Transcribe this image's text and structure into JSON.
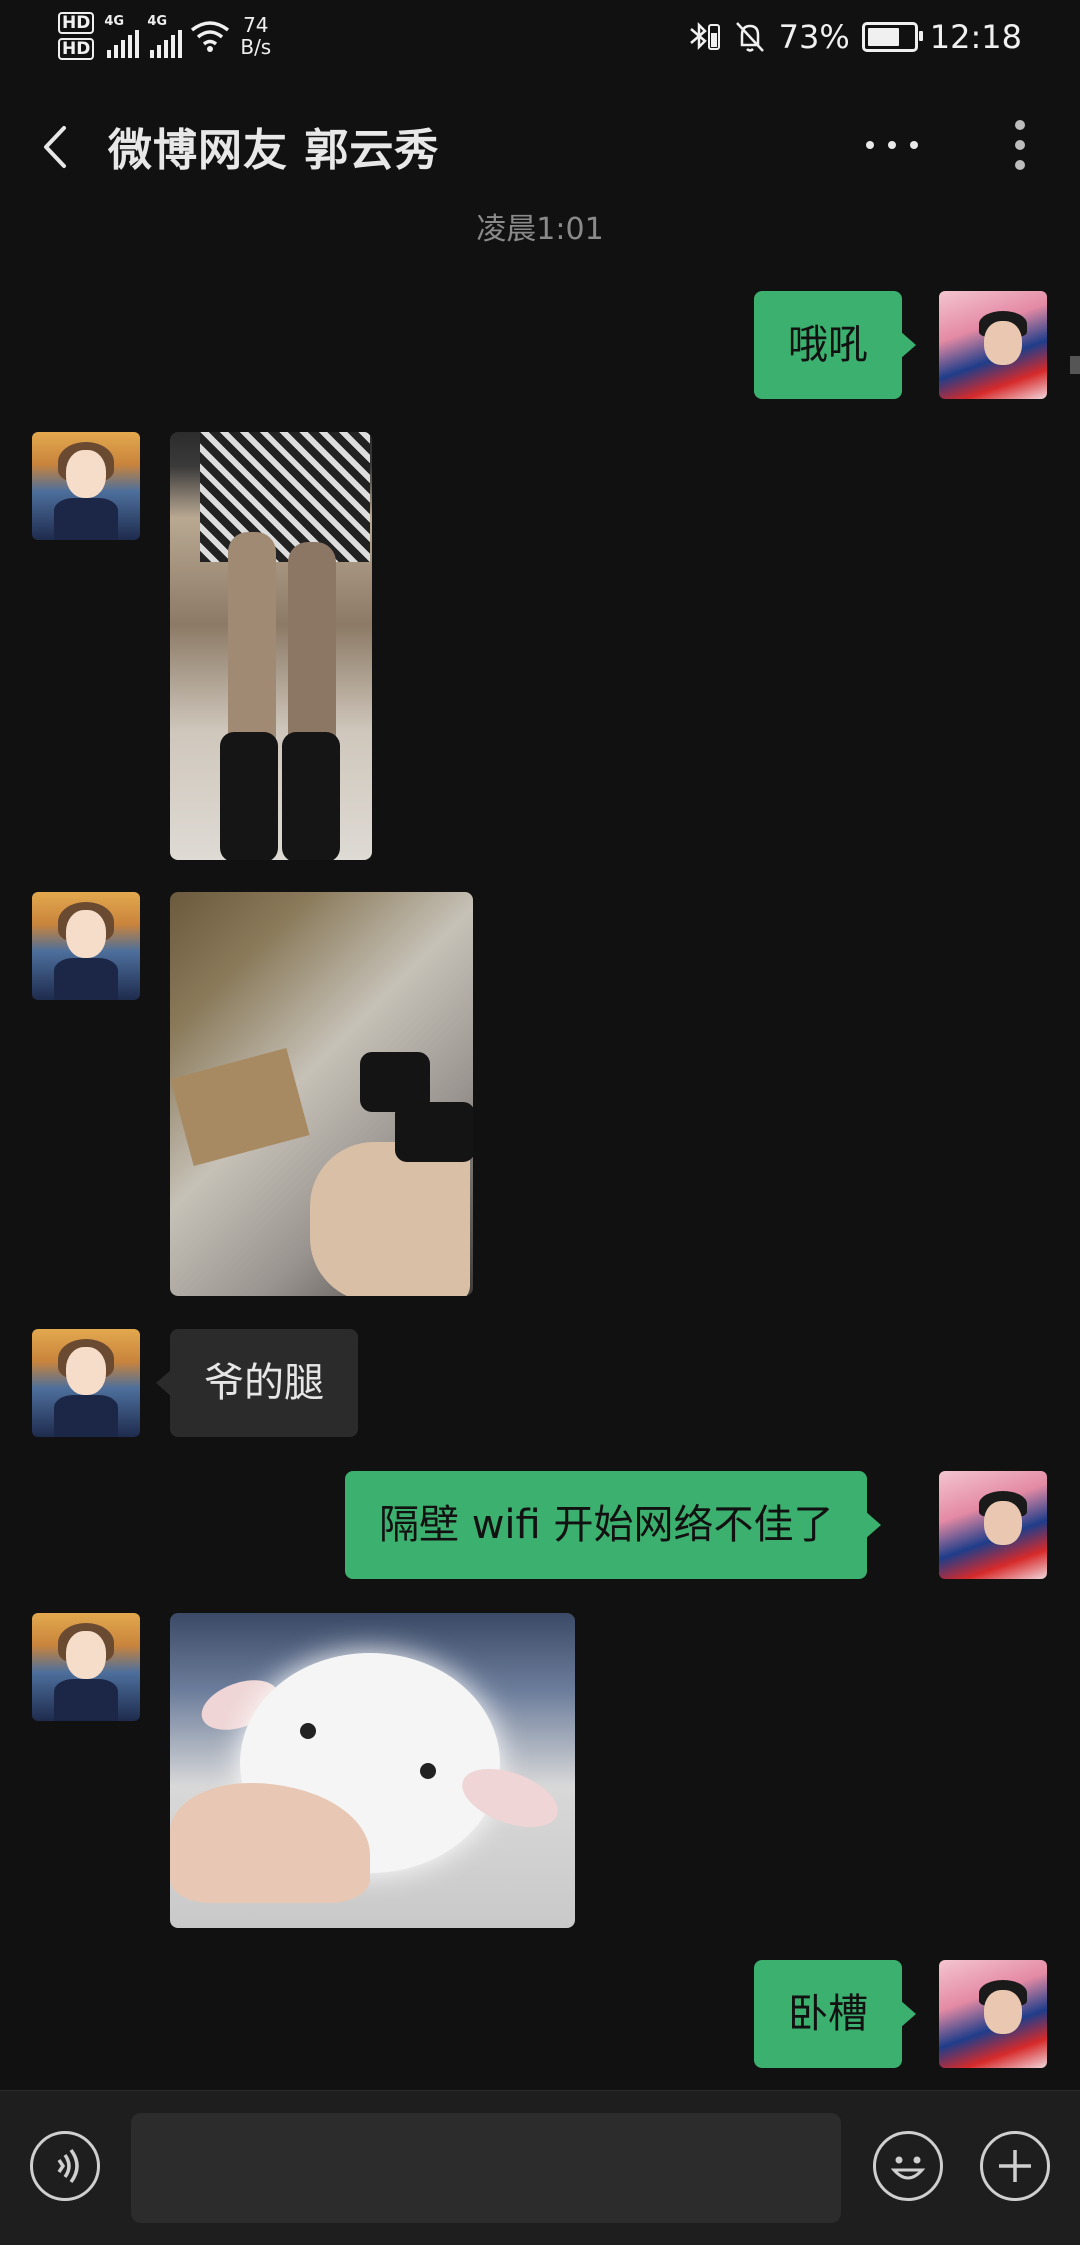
{
  "status_bar": {
    "hd1": "HD",
    "hd2": "HD",
    "signal1_label": "4G",
    "signal2_label": "4G",
    "net_speed_value": "74",
    "net_speed_unit": "B/s",
    "battery_percent": "73%",
    "battery_level": 0.73,
    "time": "12:18",
    "icons": [
      "bluetooth-icon",
      "mute-icon",
      "wifi-icon",
      "battery-icon"
    ]
  },
  "header": {
    "title": "微博网友 郭云秀",
    "back_icon": "chevron-left-icon",
    "more_icon": "ellipsis-icon",
    "menu_icon": "kebab-icon"
  },
  "chat": {
    "timestamp": "凌晨1:01",
    "messages": [
      {
        "from": "self",
        "type": "text",
        "text": "哦吼"
      },
      {
        "from": "other",
        "type": "image",
        "content": "photo"
      },
      {
        "from": "other",
        "type": "image",
        "content": "photo"
      },
      {
        "from": "other",
        "type": "text",
        "text": "爷的腿"
      },
      {
        "from": "self",
        "type": "text",
        "text": "隔壁 wifi 开始网络不佳了"
      },
      {
        "from": "other",
        "type": "image",
        "content": "photo"
      },
      {
        "from": "self",
        "type": "text",
        "text": "卧槽"
      }
    ]
  },
  "input_bar": {
    "voice_icon": "voice-icon",
    "emoji_icon": "emoji-icon",
    "plus_icon": "plus-icon",
    "input_value": ""
  },
  "colors": {
    "background": "#111111",
    "outgoing_bubble": "#3cb06e",
    "incoming_bubble": "#2b2b2b",
    "timestamp_text": "#8a8a8a"
  }
}
